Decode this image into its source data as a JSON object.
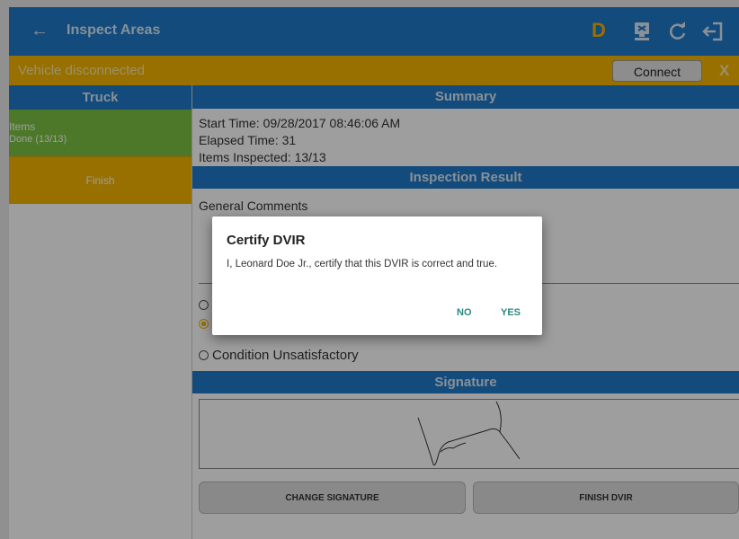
{
  "appbar": {
    "back_icon": "←",
    "title": "Inspect Areas",
    "status_letter": "D",
    "icons": [
      "device-export-icon",
      "refresh-icon",
      "logout-icon"
    ]
  },
  "connection": {
    "message": "Vehicle disconnected",
    "connect_label": "Connect",
    "close_label": "X"
  },
  "left": {
    "header": "Truck",
    "items_label": "Items",
    "items_status": "Done (13/13)",
    "finish_label": "Finish"
  },
  "summary": {
    "header": "Summary",
    "start_time": "Start Time: 09/28/2017 08:46:06 AM",
    "elapsed_time": "Elapsed Time: 31",
    "items_inspected": "Items Inspected: 13/13"
  },
  "result": {
    "header": "Inspection Result",
    "comments_label": "General Comments",
    "option_unsatisfactory": "Condition Unsatisfactory"
  },
  "signature": {
    "header": "Signature",
    "change_label": "CHANGE SIGNATURE",
    "finish_label": "FINISH DVIR"
  },
  "dialog": {
    "title": "Certify DVIR",
    "message": "I, Leonard Doe Jr., certify that this DVIR is correct and true.",
    "no_label": "NO",
    "yes_label": "YES"
  },
  "colors": {
    "primary": "#1e7ac8",
    "warning": "#f5b500",
    "success": "#7cc243",
    "dialog_action": "#2a8a7e"
  }
}
